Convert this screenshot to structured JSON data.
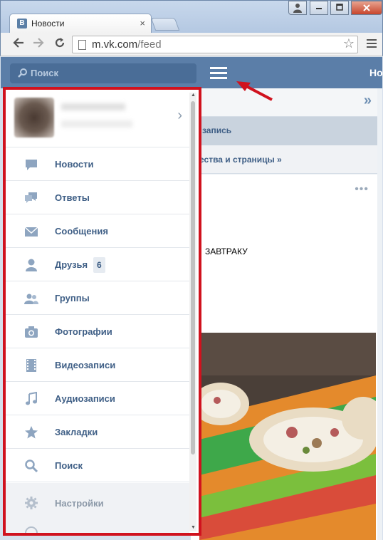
{
  "browser": {
    "tab_title": "Новости",
    "tab_favicon": "B",
    "tab_close": "×",
    "url_host": "m.vk.com",
    "url_path": "/feed"
  },
  "vk": {
    "search_placeholder": "Поиск",
    "header_right_text": "Но",
    "accent_color": "#5b7ea8",
    "highlight_color": "#d0121e"
  },
  "feed": {
    "row2_text": "запись",
    "row3_text": "ества и страницы »",
    "post_text": "ЗАВТРАКУ",
    "more_dots": "•••",
    "expand_chevron": "»"
  },
  "menu": {
    "profile_chevron": "›",
    "items": [
      {
        "label": "Новости",
        "icon": "news-icon"
      },
      {
        "label": "Ответы",
        "icon": "answers-icon"
      },
      {
        "label": "Сообщения",
        "icon": "messages-icon"
      },
      {
        "label": "Друзья",
        "icon": "friends-icon",
        "badge": "6"
      },
      {
        "label": "Группы",
        "icon": "groups-icon"
      },
      {
        "label": "Фотографии",
        "icon": "photos-icon"
      },
      {
        "label": "Видеозаписи",
        "icon": "videos-icon"
      },
      {
        "label": "Аудиозаписи",
        "icon": "audio-icon"
      },
      {
        "label": "Закладки",
        "icon": "bookmarks-icon"
      },
      {
        "label": "Поиск",
        "icon": "search-icon"
      }
    ],
    "settings_label": "Настройки"
  }
}
